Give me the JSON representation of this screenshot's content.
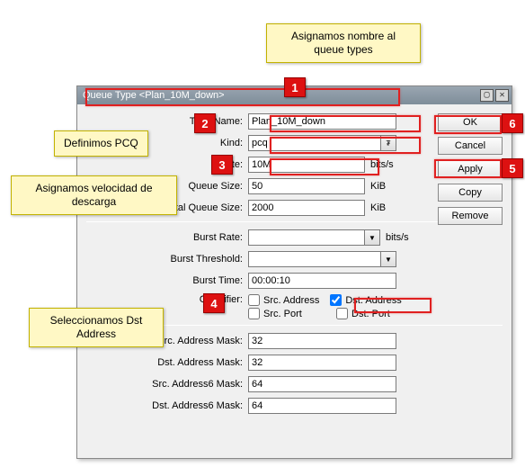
{
  "callouts": {
    "top": "Asignamos nombre al queue types",
    "pcq": "Definimos PCQ",
    "rate": "Asignamos velocidad de descarga",
    "dst": "Seleccionamos Dst Address"
  },
  "badges": {
    "n1": "1",
    "n2": "2",
    "n3": "3",
    "n4": "4",
    "n5": "5",
    "n6": "6"
  },
  "window": {
    "title": "Queue Type <Plan_10M_down>",
    "buttons": {
      "ok": "OK",
      "cancel": "Cancel",
      "apply": "Apply",
      "copy": "Copy",
      "remove": "Remove"
    }
  },
  "form": {
    "type_name": {
      "label": "Type Name:",
      "value": "Plan_10M_down"
    },
    "kind": {
      "label": "Kind:",
      "value": "pcq"
    },
    "rate": {
      "label": "Rate:",
      "value": "10M",
      "unit": "bits/s"
    },
    "queue_size": {
      "label": "Queue Size:",
      "value": "50",
      "unit": "KiB"
    },
    "total_queue_size": {
      "label": "Total Queue Size:",
      "value": "2000",
      "unit": "KiB"
    },
    "burst_rate": {
      "label": "Burst Rate:",
      "value": "",
      "unit": "bits/s"
    },
    "burst_threshold": {
      "label": "Burst Threshold:",
      "value": ""
    },
    "burst_time": {
      "label": "Burst Time:",
      "value": "00:00:10"
    },
    "classifier": {
      "label": "Classifier:",
      "src_addr": "Src. Address",
      "dst_addr": "Dst. Address",
      "src_port": "Src. Port",
      "dst_port": "Dst. Port"
    },
    "src_mask": {
      "label": "Src. Address Mask:",
      "value": "32"
    },
    "dst_mask": {
      "label": "Dst. Address Mask:",
      "value": "32"
    },
    "src6_mask": {
      "label": "Src. Address6 Mask:",
      "value": "64"
    },
    "dst6_mask": {
      "label": "Dst. Address6 Mask:",
      "value": "64"
    }
  }
}
